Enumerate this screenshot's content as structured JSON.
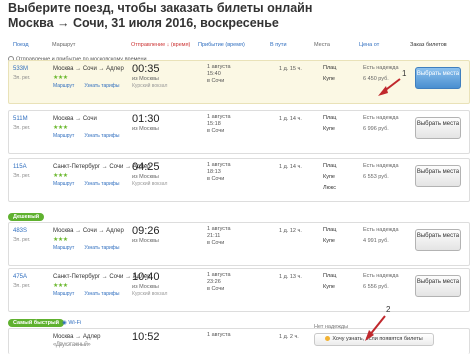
{
  "title": {
    "line1": "Выберите поезд, чтобы заказать билеты онлайн",
    "line2": "Москва → Сочи, 31 июля 2016, воскресенье"
  },
  "columns": {
    "train": "Поезд",
    "route": "Маршрут",
    "departure": "Отправление ↓ (время)",
    "arrival": "Прибытие (время)",
    "travel": "В пути",
    "seats": "Места",
    "price": "Цена от",
    "order": "Заказ билетов"
  },
  "timezone_note": "Отправление и прибытие по московскому времени",
  "trains": [
    {
      "number": "533М",
      "type": "Эл. рег.",
      "route": "Москва → Сочи → Адлер",
      "stars": "★★★",
      "links": [
        "Маршрут",
        "Узнать тарифы"
      ],
      "dep_time": "00:35",
      "dep_from": "из Москвы",
      "dep_station": "Курский вокзал",
      "arr_date": "1 августа",
      "arr_time": "15:40",
      "arr_to": "в Сочи",
      "travel": "1 д. 15 ч.",
      "seats": [
        {
          "class": "Плац",
          "count": "",
          "price": "Есть надежда"
        },
        {
          "class": "Купе",
          "count": "",
          "price": "6 450 руб."
        }
      ],
      "button": "Выбрать места"
    },
    {
      "number": "511М",
      "type": "Эл. рег.",
      "route": "Москва → Сочи",
      "stars": "★★★",
      "links": [
        "Маршрут",
        "Узнать тарифы"
      ],
      "dep_time": "01:30",
      "dep_from": "из Москвы",
      "dep_station": "",
      "arr_date": "1 августа",
      "arr_time": "15:18",
      "arr_to": "в Сочи",
      "travel": "1 д. 14 ч.",
      "seats": [
        {
          "class": "Плац",
          "count": "",
          "price": "Есть надежда"
        },
        {
          "class": "Купе",
          "count": "",
          "price": "6 996 руб."
        }
      ],
      "button": "Выбрать места"
    },
    {
      "number": "115А",
      "type": "Эл. рег.",
      "route": "Санкт-Петербург → Сочи → Адлер",
      "stars": "★★★",
      "links": [
        "Маршрут",
        "Узнать тарифы"
      ],
      "dep_time": "04:25",
      "dep_from": "из Москвы",
      "dep_station": "Курский вокзал",
      "arr_date": "1 августа",
      "arr_time": "18:13",
      "arr_to": "в Сочи",
      "travel": "1 д. 14 ч.",
      "seats": [
        {
          "class": "Плац",
          "count": "",
          "price": "Есть надежда"
        },
        {
          "class": "Купе",
          "count": "",
          "price": "6 553 руб."
        },
        {
          "class": "Люкс",
          "count": "",
          "price": ""
        }
      ],
      "button": "Выбрать места"
    },
    {
      "badge": "Дешевый",
      "number": "483S",
      "type": "Эл. рег.",
      "route": "Москва → Сочи → Адлер",
      "stars": "★★★",
      "links": [
        "Маршрут",
        "Узнать тарифы"
      ],
      "dep_time": "09:26",
      "dep_from": "из Москвы",
      "dep_station": "",
      "arr_date": "1 августа",
      "arr_time": "21:11",
      "arr_to": "в Сочи",
      "travel": "1 д. 12 ч.",
      "seats": [
        {
          "class": "Плац",
          "count": "",
          "price": "Есть надежда"
        },
        {
          "class": "Купе",
          "count": "",
          "price": "4 991 руб."
        }
      ],
      "button": "Выбрать места"
    },
    {
      "number": "475А",
      "type": "Эл. рег.",
      "route": "Санкт-Петербург → Сочи → Адлер",
      "stars": "★★★",
      "links": [
        "Маршрут",
        "Узнать тарифы"
      ],
      "dep_time": "10:40",
      "dep_from": "из Москвы",
      "dep_station": "Курский вокзал",
      "arr_date": "1 августа",
      "arr_time": "23:26",
      "arr_to": "в Сочи",
      "travel": "1 д. 13 ч.",
      "seats": [
        {
          "class": "Плац",
          "count": "",
          "price": "Есть надежда"
        },
        {
          "class": "Купе",
          "count": "",
          "price": "6 556 руб."
        }
      ],
      "button": "Выбрать места"
    }
  ],
  "last_train": {
    "badge": "Самый быстрый",
    "wifi": "Wi-Fi",
    "route": "Москва → Адлер",
    "subtitle": "«Двухэтажный»",
    "dep_time": "10:52",
    "arr_date": "1 августа",
    "travel": "1 д. 2 ч.",
    "no_seats": "Нет надежды",
    "notify_button": "Хочу узнать, если появятся билеты"
  },
  "callouts": {
    "one": "1",
    "two": "2"
  },
  "colors": {
    "accent_link": "#2f6ebf",
    "badge_green": "#5fb12f",
    "arrow_red": "#c0282d",
    "highlight_row": "#fbf8e4"
  }
}
